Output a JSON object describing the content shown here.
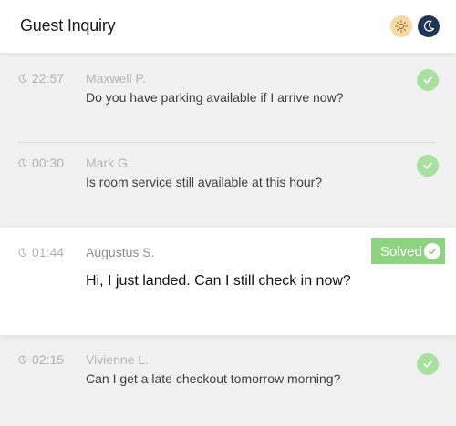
{
  "header": {
    "title": "Guest Inquiry",
    "light_mode_icon": "sun-icon",
    "dark_mode_icon": "moon-icon"
  },
  "colors": {
    "accent_green": "#8ed37f",
    "check_green": "#a9e0a0",
    "dark_navy": "#1f3558",
    "sun_bg": "#f6d9a3"
  },
  "inquiries": [
    {
      "time": "22:57",
      "name": "Maxwell P.",
      "message": "Do you have parking available if I arrive now?",
      "status": "solved"
    },
    {
      "time": "00:30",
      "name": "Mark G.",
      "message": "Is room service still available at this hour?",
      "status": "solved"
    },
    {
      "time": "01:44",
      "name": "Augustus S.",
      "message": "Hi, I just landed. Can I still check in now?",
      "status": "solved",
      "badge": "Solved",
      "selected": true
    },
    {
      "time": "02:15",
      "name": "Vivienne L.",
      "message": "Can I get a late checkout tomorrow morning?",
      "status": "solved"
    }
  ]
}
